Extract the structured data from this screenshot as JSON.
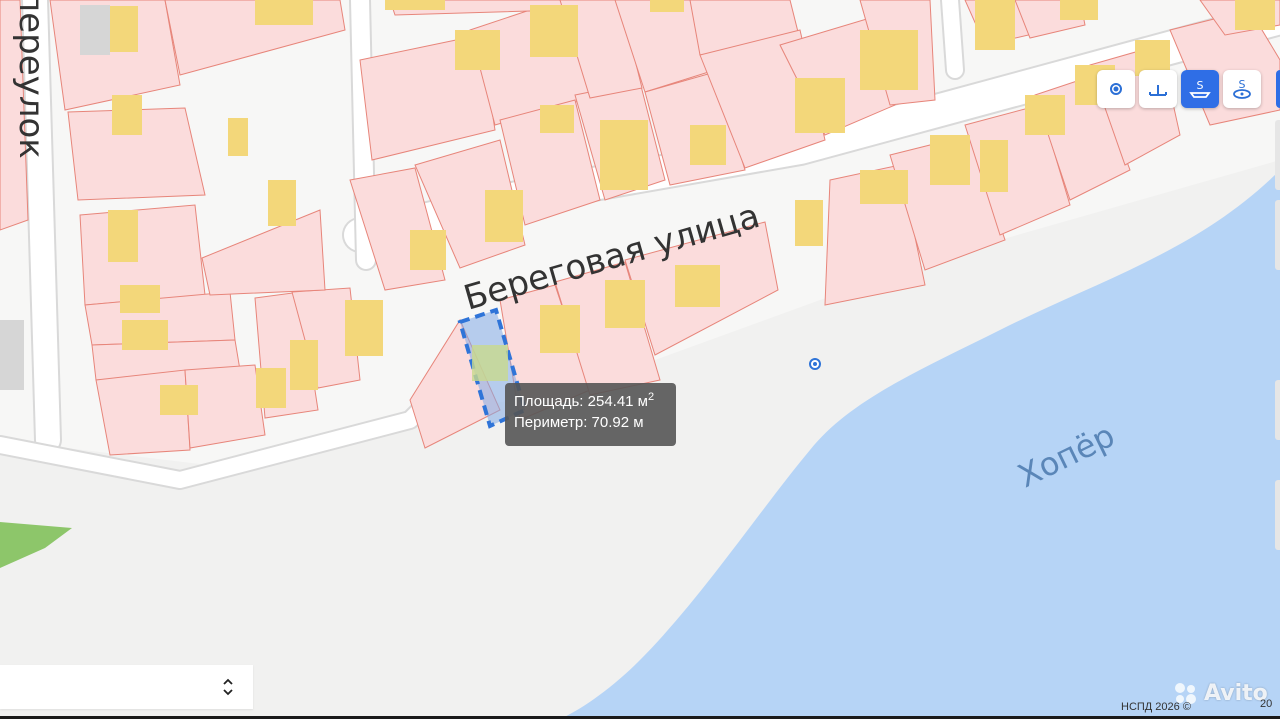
{
  "map": {
    "street_label": "Береговая  улица",
    "lane_label": "переулок",
    "river_label": "Хопёр"
  },
  "measure_tooltip": {
    "area_label": "Площадь: 254.41 м",
    "area_superscript": "2",
    "perimeter_label": "Периметр: 70.92 м"
  },
  "toolbar": {
    "tools": [
      {
        "name": "point-tool",
        "icon": "dot-icon",
        "active": false
      },
      {
        "name": "distance-tool",
        "icon": "ruler-icon",
        "active": false
      },
      {
        "name": "area-tool",
        "icon": "area-measure-icon",
        "active": true
      },
      {
        "name": "circle-area-tool",
        "icon": "circle-measure-icon",
        "active": false
      }
    ]
  },
  "attribution": {
    "text": "НСПД 2026 ©",
    "scale_text": "20"
  },
  "watermark": {
    "text": "Avito"
  },
  "colors": {
    "parcel_fill": "#fbdcdc",
    "parcel_stroke": "#e7857a",
    "building_fill": "#f3d77a",
    "water": "#b6d4f6",
    "road": "#ffffff",
    "selection": "#2f74d8",
    "green_area": "#8dc66a",
    "accent": "#2f6ee6"
  }
}
